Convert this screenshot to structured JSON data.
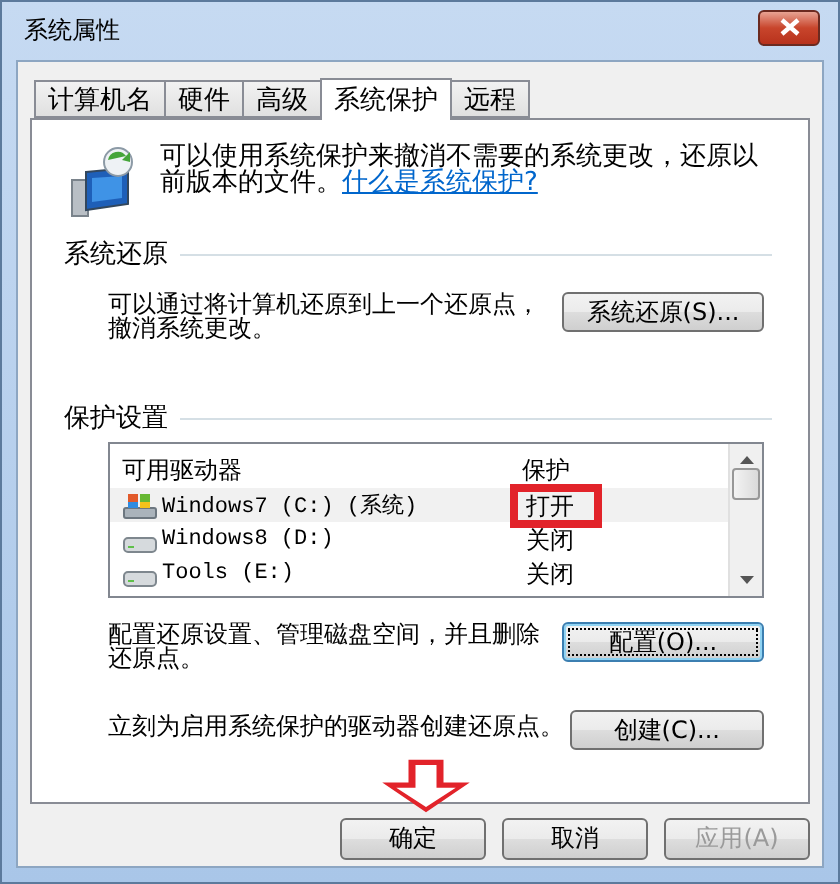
{
  "window": {
    "title": "系统属性"
  },
  "tabs": [
    {
      "label": "计算机名",
      "selected": false
    },
    {
      "label": "硬件",
      "selected": false
    },
    {
      "label": "高级",
      "selected": false
    },
    {
      "label": "系统保护",
      "selected": true
    },
    {
      "label": "远程",
      "selected": false
    }
  ],
  "intro": {
    "text": "可以使用系统保护来撤消不需要的系统更改，还原以前版本的文件。",
    "link": "什么是系统保护?"
  },
  "restore_group": {
    "title": "系统还原",
    "description": "可以通过将计算机还原到上一个还原点，撤消系统更改。",
    "button": "系统还原(S)..."
  },
  "protection_group": {
    "title": "保护设置",
    "columns": [
      "可用驱动器",
      "保护"
    ],
    "drives": [
      {
        "name": "Windows7 (C:) (系统)",
        "protection": "打开",
        "kind": "system",
        "selected": true,
        "highlighted": true
      },
      {
        "name": "Windows8 (D:)",
        "protection": "关闭",
        "kind": "disk",
        "selected": false,
        "highlighted": false
      },
      {
        "name": "Tools (E:)",
        "protection": "关闭",
        "kind": "disk",
        "selected": false,
        "highlighted": false
      }
    ],
    "configure": {
      "text": "配置还原设置、管理磁盘空间，并且删除还原点。",
      "button": "配置(O)...",
      "focused": true
    },
    "create": {
      "text": "立刻为启用系统保护的驱动器创建还原点。",
      "button": "创建(C)...",
      "focused": false
    }
  },
  "buttons": [
    {
      "label": "确定",
      "disabled": false,
      "pointed": true
    },
    {
      "label": "取消",
      "disabled": false,
      "pointed": false
    },
    {
      "label": "应用(A)",
      "disabled": true,
      "pointed": false
    }
  ]
}
